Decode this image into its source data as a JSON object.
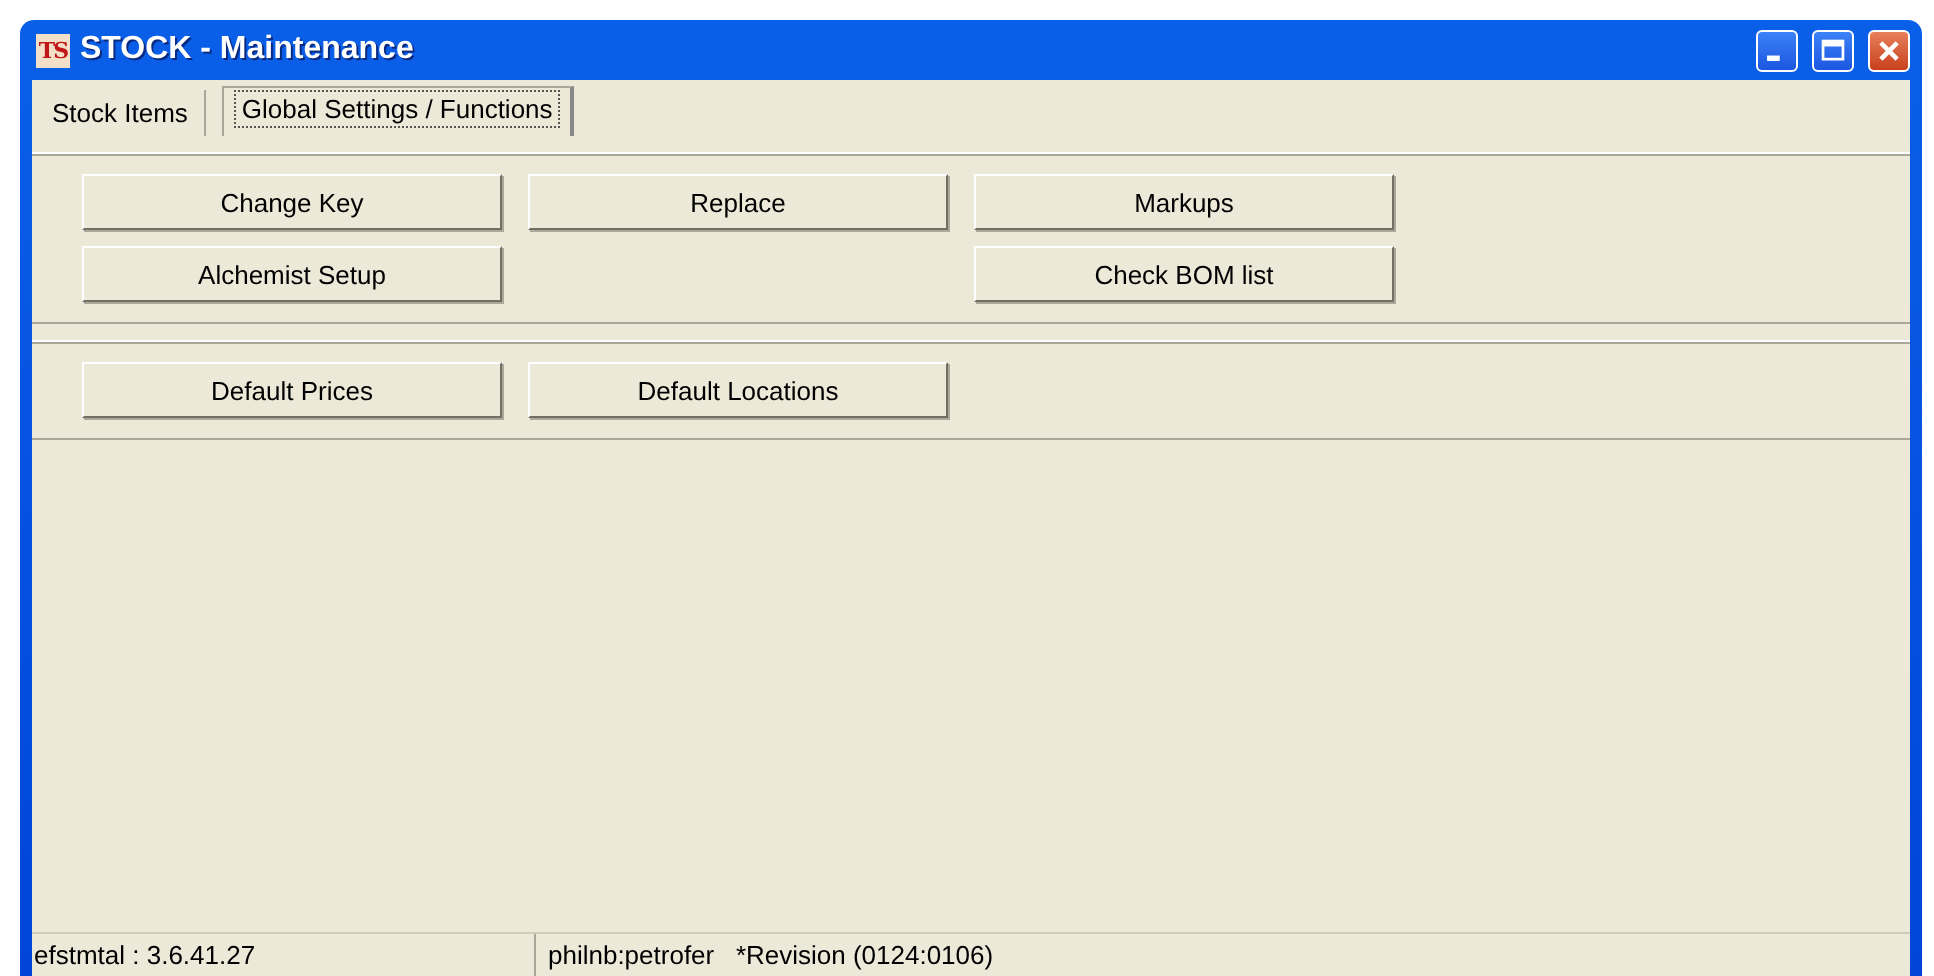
{
  "window": {
    "title": "STOCK - Maintenance",
    "app_icon": "TS"
  },
  "tabs": [
    {
      "label": "Stock Items",
      "selected": false
    },
    {
      "label": "Global Settings / Functions",
      "selected": true
    }
  ],
  "button_groups": [
    {
      "rows": [
        [
          {
            "kind": "button",
            "label": "Change Key"
          },
          {
            "kind": "button",
            "label": "Replace"
          },
          {
            "kind": "button",
            "label": "Markups"
          }
        ],
        [
          {
            "kind": "button",
            "label": "Alchemist Setup"
          },
          {
            "kind": "spacer"
          },
          {
            "kind": "button",
            "label": "Check BOM list"
          }
        ]
      ]
    },
    {
      "rows": [
        [
          {
            "kind": "button",
            "label": "Default Prices"
          },
          {
            "kind": "button",
            "label": "Default Locations"
          }
        ]
      ]
    }
  ],
  "status_bar": [
    "efstmtal : 3.6.41.27",
    "philnb:petrofer   *Revision (0124:0106)"
  ]
}
